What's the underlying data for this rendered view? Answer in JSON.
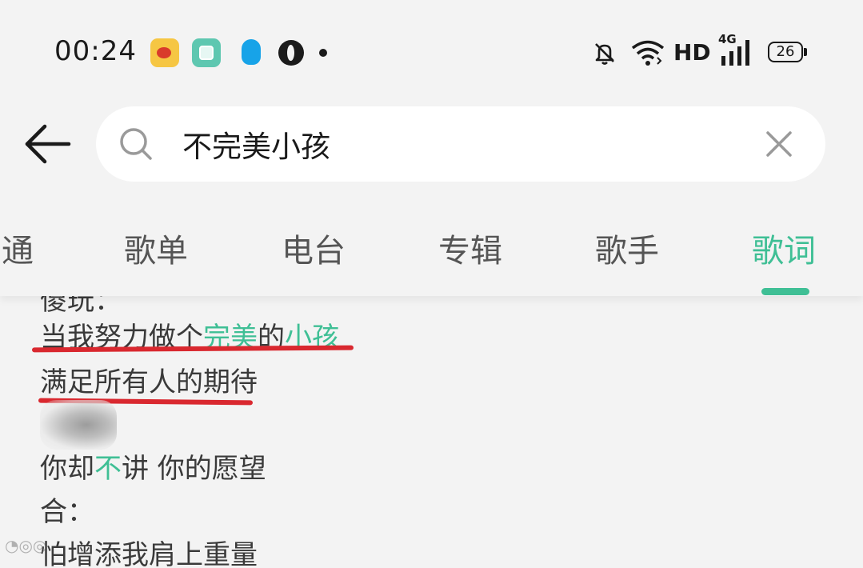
{
  "status_bar": {
    "time": "00:24",
    "network_label": "HD",
    "network_type": "4G",
    "battery": "26",
    "icons": [
      "weibo-icon",
      "square-app-icon",
      "qq-penguin-icon",
      "globe-icon",
      "notification-dot",
      "bell-off-icon",
      "wifi-icon",
      "signal-icon",
      "battery-icon"
    ]
  },
  "search": {
    "query": "不完美小孩"
  },
  "tabs": [
    {
      "label": "通",
      "active": false
    },
    {
      "label": "歌单",
      "active": false
    },
    {
      "label": "电台",
      "active": false
    },
    {
      "label": "专辑",
      "active": false
    },
    {
      "label": "歌手",
      "active": false
    },
    {
      "label": "歌词",
      "active": true
    }
  ],
  "lyrics": {
    "partial_top": "傻玩：",
    "line1": {
      "a": "当我努力做个",
      "b": "完美",
      "c": "的",
      "d": "小孩"
    },
    "line2": "满足所有人的期待",
    "line4": {
      "a": "你却",
      "b": "不",
      "c": "讲 你的愿望"
    },
    "line5": "合：",
    "line6": "怕增添我肩上重量"
  },
  "colors": {
    "accent": "#3fbf95",
    "underline": "#d9282f",
    "background": "#f3f3f3"
  }
}
